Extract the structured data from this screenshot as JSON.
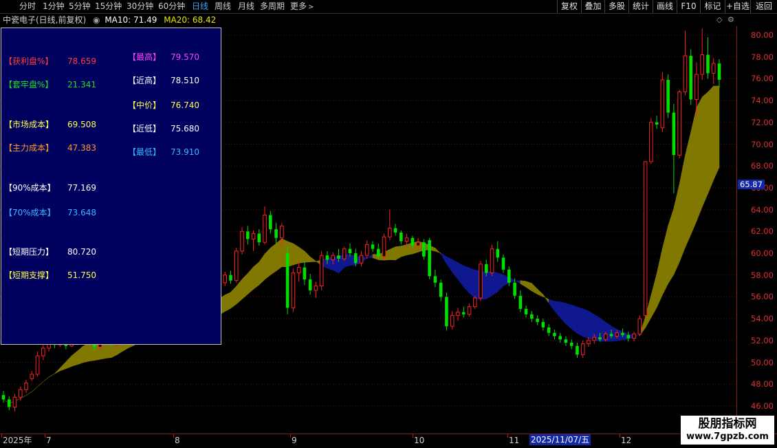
{
  "toolbar": {
    "periods": [
      "分时",
      "1分钟",
      "5分钟",
      "15分钟",
      "30分钟",
      "60分钟",
      "日线",
      "周线",
      "月线",
      "多周期",
      "更多"
    ],
    "active_period": "日线",
    "buttons": [
      "复权",
      "叠加",
      "多股",
      "统计",
      "画线",
      "F10",
      "标记",
      "+自选",
      "返回"
    ]
  },
  "info": {
    "stock": "中瓷电子(日线,前复权)",
    "ma10_label": "MA10: 71.49",
    "ma20_label": "MA20: 68.42",
    "ma10_color": "#ffffff",
    "ma20_color": "#e8e800"
  },
  "panel": {
    "left": [
      {
        "label": "【获利盘%】",
        "value": "78.659",
        "color": "#ff3b3b"
      },
      {
        "label": "【套牢盘%】",
        "value": "21.341",
        "color": "#22dd22"
      },
      {
        "label": "【市场成本】",
        "value": "69.508",
        "color": "#ffff55"
      },
      {
        "label": "【主力成本】",
        "value": "47.383",
        "color": "#ff9a2a"
      },
      {
        "label": "【90%成本】",
        "value": "77.169",
        "color": "#ffffff"
      },
      {
        "label": "【70%成本】",
        "value": "73.648",
        "color": "#33bbff"
      },
      {
        "label": "【短期压力】",
        "value": "80.720",
        "color": "#ffffff"
      },
      {
        "label": "【短期支撑】",
        "value": "51.750",
        "color": "#ffff55"
      }
    ],
    "right": [
      {
        "label": "【最高】",
        "value": "79.570",
        "color": "#ff44ff"
      },
      {
        "label": "【近高】",
        "value": "78.510",
        "color": "#ffffff"
      },
      {
        "label": "【中价】",
        "value": "76.740",
        "color": "#ffff55"
      },
      {
        "label": "【近低】",
        "value": "75.680",
        "color": "#ffffff"
      },
      {
        "label": "【最低】",
        "value": "73.910",
        "color": "#33bbff"
      }
    ]
  },
  "axis": {
    "ticks": [
      "80.00",
      "78.00",
      "76.00",
      "74.00",
      "72.00",
      "70.00",
      "68.00",
      "66.00",
      "64.00",
      "62.00",
      "60.00",
      "58.00",
      "56.00",
      "54.00",
      "52.00",
      "50.00",
      "48.00",
      "46.00"
    ],
    "current_price": "65.87"
  },
  "dates": {
    "labels": [
      "2025年",
      "7",
      "8",
      "9",
      "10",
      "11",
      "12"
    ],
    "highlight": "2025/11/07/五"
  },
  "watermark": {
    "line1": "股朋指标网",
    "line2": "www.7gpzb.com"
  },
  "colors": {
    "up": "#ff2020",
    "down": "#00e000",
    "band_up": "#807800",
    "band_down": "#101890"
  },
  "chart_data": {
    "type": "candlestick",
    "ylim": [
      46,
      81
    ],
    "candles_ohlc": [
      [
        47.0,
        47.4,
        46.3,
        46.6
      ],
      [
        46.6,
        46.9,
        45.6,
        45.9
      ],
      [
        45.9,
        47.1,
        45.5,
        46.8
      ],
      [
        46.8,
        47.8,
        46.5,
        47.5
      ],
      [
        47.5,
        48.4,
        47.2,
        48.1
      ],
      [
        48.5,
        49.2,
        48.3,
        48.9
      ],
      [
        48.9,
        51.0,
        48.7,
        50.6
      ],
      [
        50.6,
        51.6,
        50.2,
        51.3
      ],
      [
        51.3,
        52.5,
        51.0,
        52.2
      ],
      [
        52.2,
        52.6,
        51.3,
        51.6
      ],
      [
        51.6,
        52.4,
        51.4,
        52.0
      ],
      [
        52.0,
        52.3,
        51.2,
        51.5
      ],
      [
        51.5,
        52.5,
        51.4,
        52.2
      ],
      [
        52.2,
        52.6,
        51.6,
        51.9
      ],
      [
        51.9,
        52.8,
        51.7,
        52.5
      ],
      [
        52.5,
        52.8,
        51.8,
        52.0
      ],
      [
        52.0,
        52.4,
        51.1,
        51.4
      ],
      [
        51.4,
        52.0,
        51.2,
        51.8
      ],
      [
        51.8,
        52.5,
        51.6,
        52.3
      ],
      [
        52.3,
        52.6,
        51.4,
        51.6
      ],
      [
        51.6,
        52.2,
        51.4,
        51.9
      ],
      [
        51.9,
        52.6,
        51.7,
        52.4
      ],
      [
        52.4,
        53.0,
        52.1,
        52.8
      ],
      [
        52.8,
        53.2,
        52.0,
        52.3
      ],
      [
        52.3,
        53.0,
        52.1,
        52.7
      ],
      [
        52.7,
        53.3,
        52.4,
        53.1
      ],
      [
        53.1,
        53.8,
        52.9,
        53.5
      ],
      [
        53.5,
        54.2,
        53.2,
        53.9
      ],
      [
        53.9,
        54.6,
        53.6,
        54.3
      ],
      [
        54.3,
        55.1,
        54.1,
        54.8
      ],
      [
        54.8,
        55.4,
        54.5,
        55.0
      ],
      [
        55.0,
        55.6,
        54.4,
        54.7
      ],
      [
        54.7,
        55.9,
        54.5,
        55.6
      ],
      [
        55.6,
        56.4,
        55.3,
        56.0
      ],
      [
        56.0,
        56.5,
        55.5,
        55.8
      ],
      [
        55.8,
        56.8,
        55.6,
        56.5
      ],
      [
        56.5,
        57.0,
        55.8,
        56.1
      ],
      [
        56.1,
        56.9,
        55.9,
        56.7
      ],
      [
        56.7,
        57.6,
        56.4,
        57.3
      ],
      [
        57.3,
        58.3,
        57.0,
        58.0
      ],
      [
        58.0,
        58.4,
        57.2,
        57.5
      ],
      [
        57.5,
        60.5,
        57.3,
        60.2
      ],
      [
        60.2,
        62.4,
        59.9,
        62.0
      ],
      [
        62.0,
        62.5,
        60.8,
        61.3
      ],
      [
        61.3,
        62.1,
        60.2,
        61.8
      ],
      [
        61.8,
        62.2,
        60.7,
        61.0
      ],
      [
        61.0,
        64.3,
        60.8,
        63.5
      ],
      [
        63.5,
        63.9,
        61.8,
        62.2
      ],
      [
        62.2,
        62.8,
        60.9,
        61.4
      ],
      [
        61.4,
        62.8,
        60.6,
        62.5
      ],
      [
        60.0,
        60.6,
        54.4,
        55.0
      ],
      [
        55.0,
        58.6,
        54.6,
        58.2
      ],
      [
        58.2,
        59.3,
        57.4,
        58.7
      ],
      [
        58.7,
        59.2,
        57.1,
        57.6
      ],
      [
        57.6,
        58.1,
        56.2,
        56.6
      ],
      [
        56.6,
        57.4,
        55.9,
        57.0
      ],
      [
        57.0,
        60.2,
        56.6,
        59.8
      ],
      [
        59.8,
        60.2,
        59.0,
        59.4
      ],
      [
        59.4,
        60.1,
        59.0,
        59.8
      ],
      [
        59.8,
        60.4,
        59.2,
        59.5
      ],
      [
        59.5,
        60.6,
        59.3,
        60.4
      ],
      [
        60.4,
        60.9,
        59.7,
        60.0
      ],
      [
        60.0,
        60.4,
        58.8,
        59.1
      ],
      [
        59.1,
        60.2,
        58.8,
        59.8
      ],
      [
        59.8,
        61.2,
        59.5,
        60.8
      ],
      [
        60.8,
        61.1,
        60.1,
        60.4
      ],
      [
        60.4,
        60.9,
        59.5,
        59.7
      ],
      [
        59.7,
        61.8,
        59.4,
        61.5
      ],
      [
        61.5,
        64.0,
        61.2,
        62.3
      ],
      [
        62.3,
        62.7,
        61.6,
        61.9
      ],
      [
        61.9,
        62.1,
        60.8,
        61.1
      ],
      [
        61.1,
        61.8,
        60.6,
        61.4
      ],
      [
        61.4,
        61.6,
        60.5,
        60.7
      ],
      [
        60.7,
        61.4,
        60.3,
        61.0
      ],
      [
        61.0,
        61.3,
        59.4,
        59.7
      ],
      [
        61.2,
        61.4,
        57.6,
        57.9
      ],
      [
        57.9,
        58.5,
        56.9,
        57.3
      ],
      [
        57.3,
        57.6,
        55.6,
        56.0
      ],
      [
        56.0,
        56.4,
        52.9,
        53.3
      ],
      [
        53.3,
        54.7,
        53.0,
        54.3
      ],
      [
        54.3,
        55.0,
        53.8,
        54.6
      ],
      [
        54.6,
        55.1,
        54.1,
        54.4
      ],
      [
        54.4,
        55.4,
        54.2,
        55.1
      ],
      [
        55.1,
        56.1,
        54.9,
        55.9
      ],
      [
        55.9,
        59.3,
        55.6,
        59.0
      ],
      [
        59.0,
        59.4,
        57.9,
        58.2
      ],
      [
        58.2,
        60.8,
        57.9,
        60.4
      ],
      [
        60.4,
        61.1,
        59.2,
        59.6
      ],
      [
        59.6,
        59.9,
        58.2,
        58.5
      ],
      [
        58.5,
        58.8,
        57.0,
        57.3
      ],
      [
        57.3,
        57.7,
        55.8,
        56.1
      ],
      [
        56.1,
        56.6,
        54.6,
        54.9
      ],
      [
        54.9,
        55.2,
        54.1,
        54.4
      ],
      [
        54.4,
        54.7,
        53.7,
        54.0
      ],
      [
        54.0,
        54.3,
        53.4,
        53.7
      ],
      [
        53.7,
        54.0,
        52.9,
        53.2
      ],
      [
        53.2,
        53.5,
        52.4,
        52.7
      ],
      [
        52.7,
        53.0,
        52.1,
        52.4
      ],
      [
        52.4,
        52.7,
        51.8,
        52.1
      ],
      [
        52.1,
        52.4,
        51.5,
        51.8
      ],
      [
        51.8,
        52.1,
        51.2,
        51.5
      ],
      [
        51.5,
        51.8,
        50.4,
        50.7
      ],
      [
        50.7,
        52.0,
        50.4,
        51.7
      ],
      [
        51.7,
        52.3,
        51.4,
        52.0
      ],
      [
        52.0,
        52.6,
        51.7,
        52.3
      ],
      [
        52.3,
        52.7,
        51.9,
        52.1
      ],
      [
        52.1,
        52.8,
        51.9,
        52.6
      ],
      [
        52.6,
        53.0,
        52.2,
        52.4
      ],
      [
        52.4,
        52.9,
        52.2,
        52.7
      ],
      [
        52.7,
        53.1,
        52.3,
        52.5
      ],
      [
        52.5,
        52.8,
        51.9,
        52.2
      ],
      [
        52.2,
        52.8,
        51.9,
        52.6
      ],
      [
        52.6,
        54.3,
        52.4,
        54.0
      ],
      [
        54.3,
        68.4,
        54.1,
        68.4
      ],
      [
        68.4,
        72.4,
        68.2,
        72.0
      ],
      [
        72.0,
        72.6,
        71.4,
        71.8
      ],
      [
        71.5,
        76.6,
        71.1,
        75.9
      ],
      [
        75.9,
        76.4,
        72.4,
        72.9
      ],
      [
        72.9,
        73.7,
        65.5,
        69.0
      ],
      [
        69.0,
        75.0,
        68.7,
        74.8
      ],
      [
        74.8,
        80.4,
        74.5,
        78.1
      ],
      [
        78.1,
        78.7,
        73.6,
        74.1
      ],
      [
        74.1,
        77.5,
        72.5,
        76.4
      ],
      [
        76.4,
        80.6,
        75.9,
        78.2
      ],
      [
        78.2,
        79.8,
        76.0,
        76.5
      ],
      [
        76.5,
        77.9,
        75.5,
        77.4
      ],
      [
        77.4,
        77.8,
        75.2,
        75.9
      ]
    ]
  }
}
